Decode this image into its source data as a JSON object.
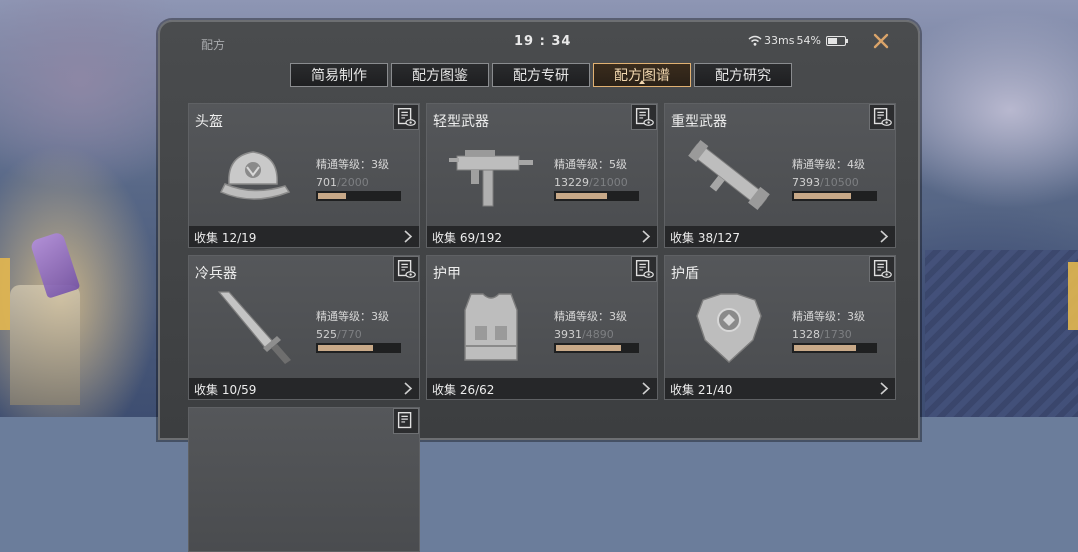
{
  "window": {
    "title": "配方",
    "time": "19 : 34",
    "ping": "33ms",
    "battery": "54%",
    "battery_level": 0.54,
    "close_icon": "close-x-icon"
  },
  "tabs": [
    {
      "label": "简易制作",
      "active": false
    },
    {
      "label": "配方图鉴",
      "active": false
    },
    {
      "label": "配方专研",
      "active": false
    },
    {
      "label": "配方图谱",
      "active": true
    },
    {
      "label": "配方研究",
      "active": false
    }
  ],
  "cards": [
    {
      "name": "头盔",
      "icon": "helmet-icon",
      "mastery": "精通等级：3级",
      "xp_current": "701",
      "xp_max": "/2000",
      "progress": 0.35,
      "collect": "收集 12/19"
    },
    {
      "name": "轻型武器",
      "icon": "smg-icon",
      "mastery": "精通等级：5级",
      "xp_current": "13229",
      "xp_max": "/21000",
      "progress": 0.63,
      "collect": "收集 69/192"
    },
    {
      "name": "重型武器",
      "icon": "rocket-launcher-icon",
      "mastery": "精通等级：4级",
      "xp_current": "7393",
      "xp_max": "/10500",
      "progress": 0.7,
      "collect": "收集 38/127"
    },
    {
      "name": "冷兵器",
      "icon": "sword-icon",
      "mastery": "精通等级：3级",
      "xp_current": "525",
      "xp_max": "/770",
      "progress": 0.68,
      "collect": "收集 10/59"
    },
    {
      "name": "护甲",
      "icon": "body-armor-icon",
      "mastery": "精通等级：3级",
      "xp_current": "3931",
      "xp_max": "/4890",
      "progress": 0.8,
      "collect": "收集 26/62"
    },
    {
      "name": "护盾",
      "icon": "shield-icon",
      "mastery": "精通等级：3级",
      "xp_current": "1328",
      "xp_max": "/1730",
      "progress": 0.77,
      "collect": "收集 21/40"
    }
  ],
  "partial_next_card": {
    "icon": "view-recipe-icon"
  }
}
